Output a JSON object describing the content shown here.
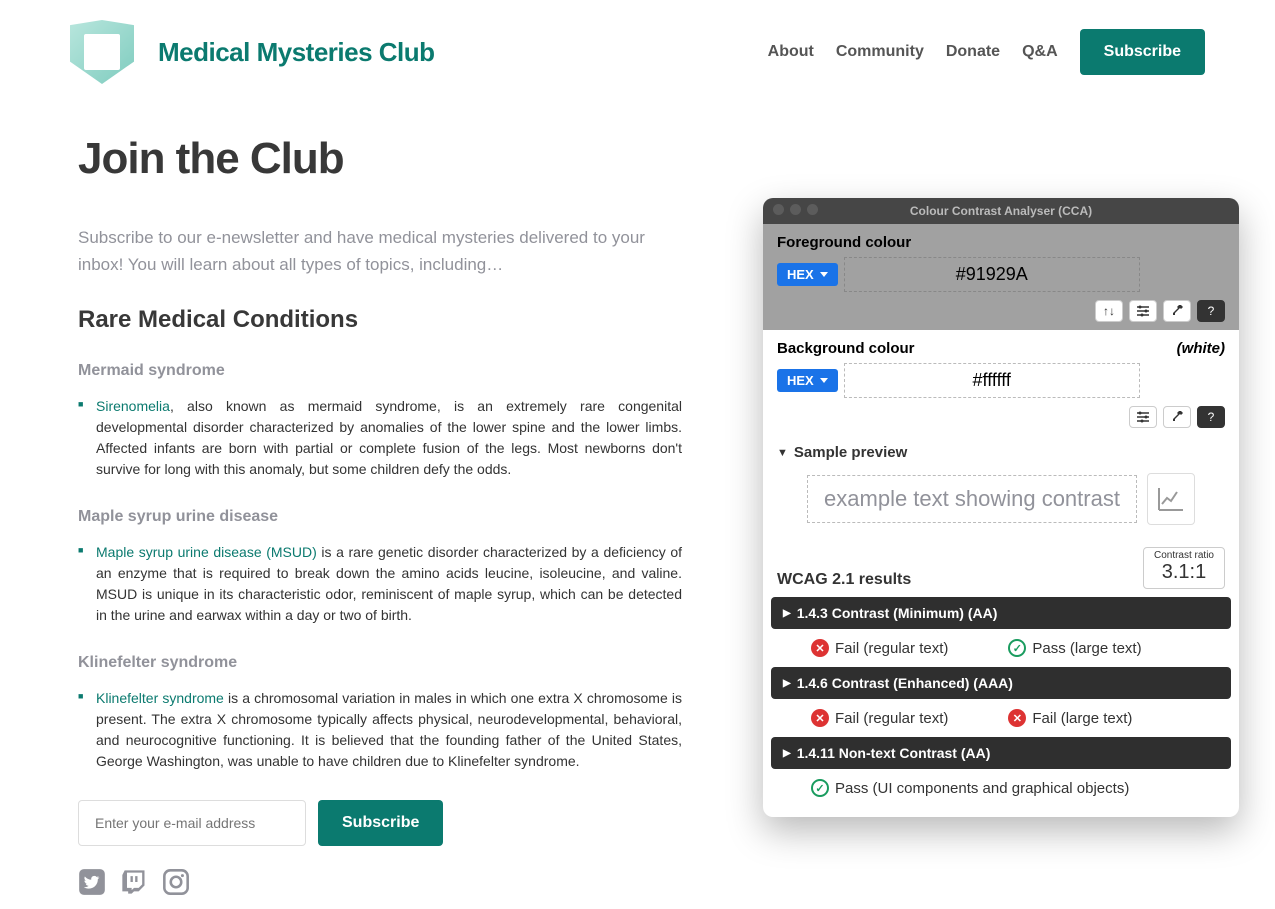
{
  "brand": {
    "title": "Medical Mysteries Club"
  },
  "nav": {
    "about": "About",
    "community": "Community",
    "donate": "Donate",
    "qa": "Q&A",
    "subscribe": "Subscribe"
  },
  "page": {
    "title": "Join the Club",
    "intro": "Subscribe to our e-newsletter and have medical mysteries delivered to your inbox! You will learn about all types of topics, including…",
    "section_heading": "Rare Medical Conditions"
  },
  "conditions": {
    "mermaid": {
      "title": "Mermaid syndrome",
      "link": "Sirenomelia",
      "text": ", also known as mermaid syndrome, is an extremely rare congenital developmental disorder characterized by anomalies of the lower spine and the lower limbs. Affected infants are born with partial or complete fusion of the legs. Most newborns don't survive for long with this anomaly, but some children defy the odds."
    },
    "maple": {
      "title": "Maple syrup urine disease",
      "link": "Maple syrup urine disease (MSUD)",
      "text": " is a rare genetic disorder characterized by a deficiency of an enzyme that is required to break down the amino acids leucine, isoleucine, and valine. MSUD is unique in its characteristic odor, reminiscent of maple syrup, which can be detected in the urine and earwax within a day or two of birth."
    },
    "klinefelter": {
      "title": "Klinefelter syndrome",
      "link": "Klinefelter syndrome",
      "text": " is a chromosomal variation in males in which one extra X chromosome is present. The extra X chromosome typically affects physical, neurodevelopmental, behavioral, and neurocognitive functioning. It is believed that the founding father of the United States, George Washington, was unable to have children due to Klinefelter syndrome."
    }
  },
  "form": {
    "email_placeholder": "Enter your e-mail address",
    "submit": "Subscribe"
  },
  "cca": {
    "title": "Colour Contrast Analyser (CCA)",
    "fg_label": "Foreground colour",
    "fg_format": "HEX",
    "fg_value": "#91929A",
    "bg_label": "Background colour",
    "bg_note": "(white)",
    "bg_format": "HEX",
    "bg_value": "#ffffff",
    "sample_label": "Sample preview",
    "sample_text": "example text showing contrast",
    "results_label": "WCAG 2.1 results",
    "ratio_label": "Contrast ratio",
    "ratio_value": "3.1:1",
    "crit1": "1.4.3 Contrast (Minimum) (AA)",
    "crit1_reg": "Fail (regular text)",
    "crit1_lg": "Pass (large text)",
    "crit2": "1.4.6 Contrast (Enhanced) (AAA)",
    "crit2_reg": "Fail (regular text)",
    "crit2_lg": "Fail (large text)",
    "crit3": "1.4.11 Non-text Contrast (AA)",
    "crit3_res": "Pass (UI components and graphical objects)"
  }
}
